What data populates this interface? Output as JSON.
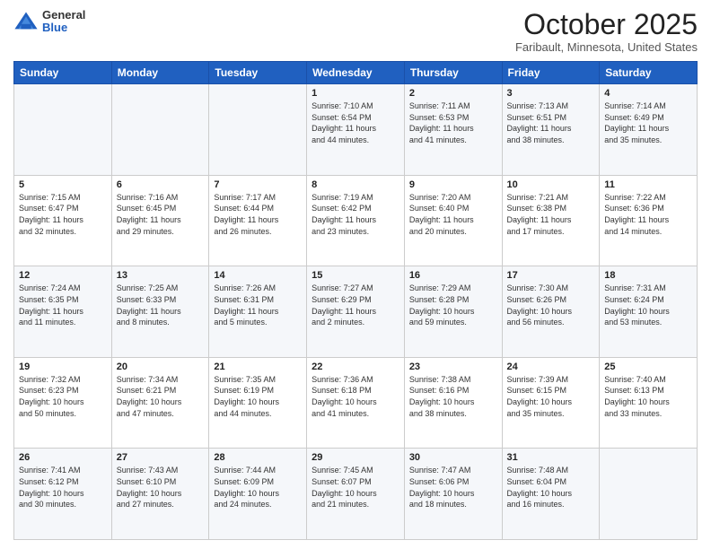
{
  "logo": {
    "general": "General",
    "blue": "Blue"
  },
  "header": {
    "month": "October 2025",
    "location": "Faribault, Minnesota, United States"
  },
  "days_of_week": [
    "Sunday",
    "Monday",
    "Tuesday",
    "Wednesday",
    "Thursday",
    "Friday",
    "Saturday"
  ],
  "weeks": [
    [
      {
        "num": "",
        "info": ""
      },
      {
        "num": "",
        "info": ""
      },
      {
        "num": "",
        "info": ""
      },
      {
        "num": "1",
        "info": "Sunrise: 7:10 AM\nSunset: 6:54 PM\nDaylight: 11 hours\nand 44 minutes."
      },
      {
        "num": "2",
        "info": "Sunrise: 7:11 AM\nSunset: 6:53 PM\nDaylight: 11 hours\nand 41 minutes."
      },
      {
        "num": "3",
        "info": "Sunrise: 7:13 AM\nSunset: 6:51 PM\nDaylight: 11 hours\nand 38 minutes."
      },
      {
        "num": "4",
        "info": "Sunrise: 7:14 AM\nSunset: 6:49 PM\nDaylight: 11 hours\nand 35 minutes."
      }
    ],
    [
      {
        "num": "5",
        "info": "Sunrise: 7:15 AM\nSunset: 6:47 PM\nDaylight: 11 hours\nand 32 minutes."
      },
      {
        "num": "6",
        "info": "Sunrise: 7:16 AM\nSunset: 6:45 PM\nDaylight: 11 hours\nand 29 minutes."
      },
      {
        "num": "7",
        "info": "Sunrise: 7:17 AM\nSunset: 6:44 PM\nDaylight: 11 hours\nand 26 minutes."
      },
      {
        "num": "8",
        "info": "Sunrise: 7:19 AM\nSunset: 6:42 PM\nDaylight: 11 hours\nand 23 minutes."
      },
      {
        "num": "9",
        "info": "Sunrise: 7:20 AM\nSunset: 6:40 PM\nDaylight: 11 hours\nand 20 minutes."
      },
      {
        "num": "10",
        "info": "Sunrise: 7:21 AM\nSunset: 6:38 PM\nDaylight: 11 hours\nand 17 minutes."
      },
      {
        "num": "11",
        "info": "Sunrise: 7:22 AM\nSunset: 6:36 PM\nDaylight: 11 hours\nand 14 minutes."
      }
    ],
    [
      {
        "num": "12",
        "info": "Sunrise: 7:24 AM\nSunset: 6:35 PM\nDaylight: 11 hours\nand 11 minutes."
      },
      {
        "num": "13",
        "info": "Sunrise: 7:25 AM\nSunset: 6:33 PM\nDaylight: 11 hours\nand 8 minutes."
      },
      {
        "num": "14",
        "info": "Sunrise: 7:26 AM\nSunset: 6:31 PM\nDaylight: 11 hours\nand 5 minutes."
      },
      {
        "num": "15",
        "info": "Sunrise: 7:27 AM\nSunset: 6:29 PM\nDaylight: 11 hours\nand 2 minutes."
      },
      {
        "num": "16",
        "info": "Sunrise: 7:29 AM\nSunset: 6:28 PM\nDaylight: 10 hours\nand 59 minutes."
      },
      {
        "num": "17",
        "info": "Sunrise: 7:30 AM\nSunset: 6:26 PM\nDaylight: 10 hours\nand 56 minutes."
      },
      {
        "num": "18",
        "info": "Sunrise: 7:31 AM\nSunset: 6:24 PM\nDaylight: 10 hours\nand 53 minutes."
      }
    ],
    [
      {
        "num": "19",
        "info": "Sunrise: 7:32 AM\nSunset: 6:23 PM\nDaylight: 10 hours\nand 50 minutes."
      },
      {
        "num": "20",
        "info": "Sunrise: 7:34 AM\nSunset: 6:21 PM\nDaylight: 10 hours\nand 47 minutes."
      },
      {
        "num": "21",
        "info": "Sunrise: 7:35 AM\nSunset: 6:19 PM\nDaylight: 10 hours\nand 44 minutes."
      },
      {
        "num": "22",
        "info": "Sunrise: 7:36 AM\nSunset: 6:18 PM\nDaylight: 10 hours\nand 41 minutes."
      },
      {
        "num": "23",
        "info": "Sunrise: 7:38 AM\nSunset: 6:16 PM\nDaylight: 10 hours\nand 38 minutes."
      },
      {
        "num": "24",
        "info": "Sunrise: 7:39 AM\nSunset: 6:15 PM\nDaylight: 10 hours\nand 35 minutes."
      },
      {
        "num": "25",
        "info": "Sunrise: 7:40 AM\nSunset: 6:13 PM\nDaylight: 10 hours\nand 33 minutes."
      }
    ],
    [
      {
        "num": "26",
        "info": "Sunrise: 7:41 AM\nSunset: 6:12 PM\nDaylight: 10 hours\nand 30 minutes."
      },
      {
        "num": "27",
        "info": "Sunrise: 7:43 AM\nSunset: 6:10 PM\nDaylight: 10 hours\nand 27 minutes."
      },
      {
        "num": "28",
        "info": "Sunrise: 7:44 AM\nSunset: 6:09 PM\nDaylight: 10 hours\nand 24 minutes."
      },
      {
        "num": "29",
        "info": "Sunrise: 7:45 AM\nSunset: 6:07 PM\nDaylight: 10 hours\nand 21 minutes."
      },
      {
        "num": "30",
        "info": "Sunrise: 7:47 AM\nSunset: 6:06 PM\nDaylight: 10 hours\nand 18 minutes."
      },
      {
        "num": "31",
        "info": "Sunrise: 7:48 AM\nSunset: 6:04 PM\nDaylight: 10 hours\nand 16 minutes."
      },
      {
        "num": "",
        "info": ""
      }
    ]
  ]
}
